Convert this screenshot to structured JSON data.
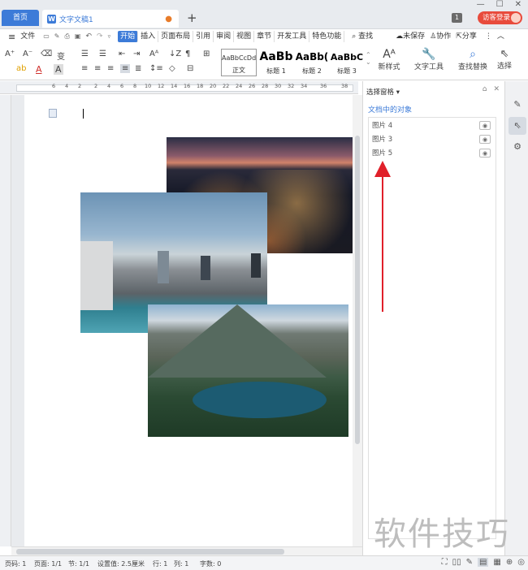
{
  "titlebar": {
    "home_tab": "首页",
    "doc_tab": "文字文稿1",
    "doc_icon": "W",
    "modified_dot": "●",
    "new_tab": "+",
    "badge": "1",
    "login": "访客登录",
    "minimize": "—",
    "maximize": "☐",
    "close": "✕"
  },
  "menubar": {
    "hamburger": "≡",
    "file": "文件",
    "items": [
      "开始",
      "插入",
      "页面布局",
      "引用",
      "审阅",
      "视图",
      "章节",
      "开发工具",
      "特色功能"
    ],
    "search": "查找",
    "unsaved": "未保存",
    "collaborate": "协作",
    "share": "分享"
  },
  "ribbon": {
    "styles": [
      {
        "sample": "AaBbCcDd",
        "label": "正文"
      },
      {
        "sample": "AaBb",
        "label": "标题 1"
      },
      {
        "sample": "AaBb(",
        "label": "标题 2"
      },
      {
        "sample": "AaBbC",
        "label": "标题 3"
      }
    ],
    "new_style": "新样式",
    "text_tools": "文字工具",
    "find_replace": "查找替换",
    "select": "选择"
  },
  "ruler": {
    "numbers": [
      "6",
      "4",
      "2",
      "2",
      "4",
      "6",
      "8",
      "10",
      "12",
      "14",
      "16",
      "18",
      "20",
      "22",
      "24",
      "26",
      "28",
      "30",
      "32",
      "34",
      "36",
      "38"
    ]
  },
  "panel": {
    "title": "选择窗格",
    "subtitle": "文档中的对象",
    "items": [
      {
        "label": "图片 4",
        "eye": "◉"
      },
      {
        "label": "图片 3",
        "eye": "◉"
      },
      {
        "label": "图片 5",
        "eye": "◉"
      }
    ]
  },
  "watermark": "软件技巧",
  "statusbar": {
    "page_num": "页码: 1",
    "pages": "页面: 1/1",
    "section": "节: 1/1",
    "setting": "设置值: 2.5厘米",
    "row": "行: 1",
    "col": "列: 1",
    "words": "字数: 0"
  },
  "colors": {
    "accent": "#3c7bd8",
    "login": "#e84b3c",
    "arrow": "#e0202a"
  }
}
